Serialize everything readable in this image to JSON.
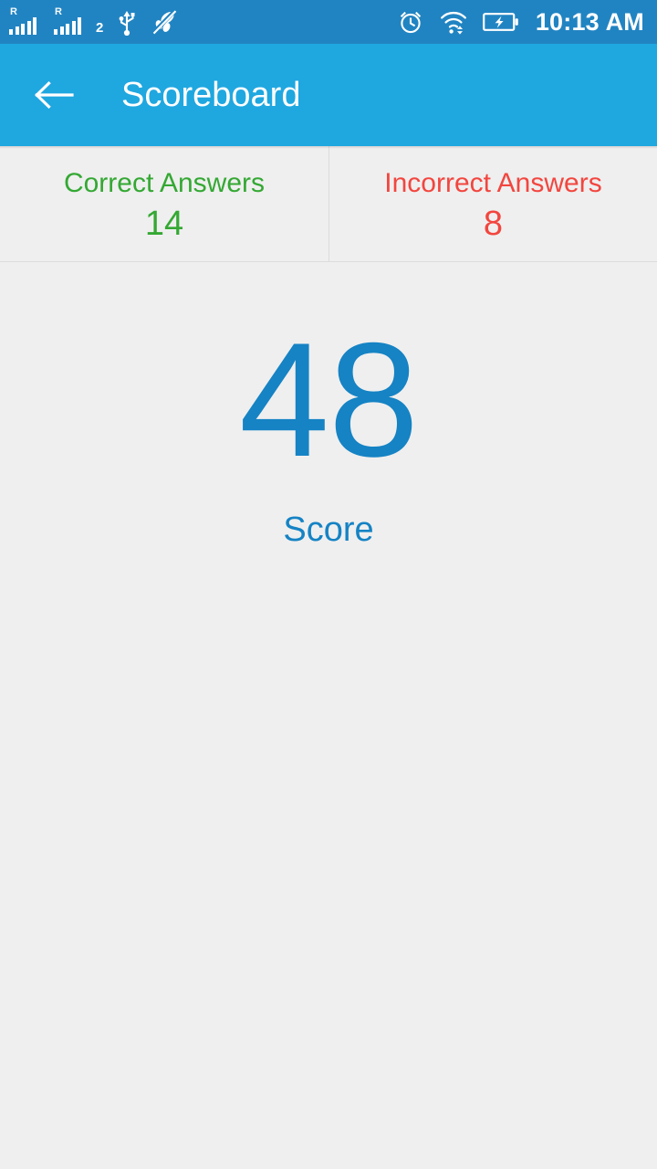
{
  "status_bar": {
    "background_color": "#2184c2",
    "sim_signals": [
      {
        "name": "sim-1-signal",
        "roaming_label": "R",
        "bars_filled": 5
      },
      {
        "name": "sim-2-signal",
        "roaming_label": "R",
        "bars_filled": 5
      }
    ],
    "sim_index_label": "2",
    "icons": [
      "usb-icon",
      "mute-slash-icon",
      "alarm-clock-icon",
      "wifi-icon",
      "battery-charging-icon"
    ],
    "time": "10:13 AM"
  },
  "app_bar": {
    "background_color": "#1fa7e0",
    "back_icon": "arrow-back-icon",
    "title": "Scoreboard"
  },
  "summary": {
    "panels": [
      {
        "id": "correct",
        "label": "Correct Answers",
        "value": "14",
        "color": "#34a833"
      },
      {
        "id": "incorrect",
        "label": "Incorrect Answers",
        "value": "8",
        "color": "#f2463f"
      }
    ]
  },
  "score": {
    "value": "48",
    "label": "Score",
    "color": "#1583c4"
  },
  "page": {
    "background_color": "#efefef"
  }
}
